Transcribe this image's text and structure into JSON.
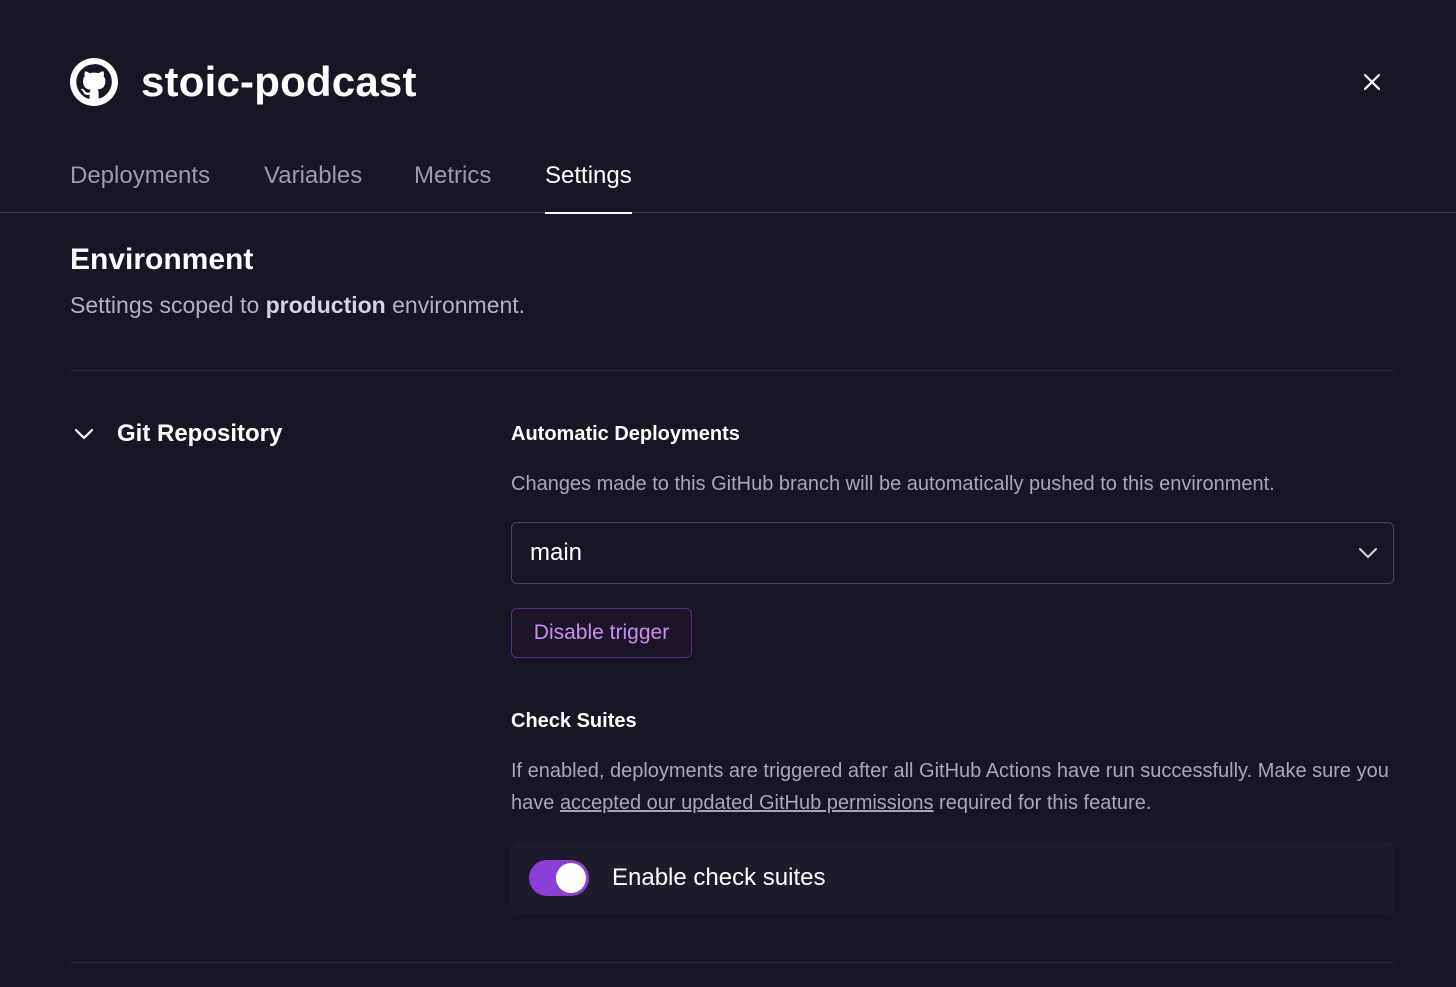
{
  "header": {
    "title": "stoic-podcast",
    "logo_icon": "github-icon",
    "close_icon": "close-icon"
  },
  "tabs": [
    {
      "label": "Deployments",
      "active": false
    },
    {
      "label": "Variables",
      "active": false
    },
    {
      "label": "Metrics",
      "active": false
    },
    {
      "label": "Settings",
      "active": true
    }
  ],
  "environment": {
    "title": "Environment",
    "subtitle_prefix": "Settings scoped to ",
    "subtitle_env": "production",
    "subtitle_suffix": " environment."
  },
  "git_repository": {
    "section_label": "Git Repository",
    "expanded": true,
    "auto_deploy": {
      "title": "Automatic Deployments",
      "description": "Changes made to this GitHub branch will be automatically pushed to this environment.",
      "branch_value": "main",
      "disable_button_label": "Disable trigger"
    },
    "check_suites": {
      "title": "Check Suites",
      "description_prefix": "If enabled, deployments are triggered after all GitHub Actions have run successfully. Make sure you have ",
      "link_text": "accepted our updated GitHub permissions",
      "description_suffix": " required for this feature.",
      "toggle_label": "Enable check suites",
      "enabled": true
    }
  },
  "colors": {
    "background": "#181624",
    "accent": "#8a3fd6",
    "button_text": "#c98ef0"
  }
}
